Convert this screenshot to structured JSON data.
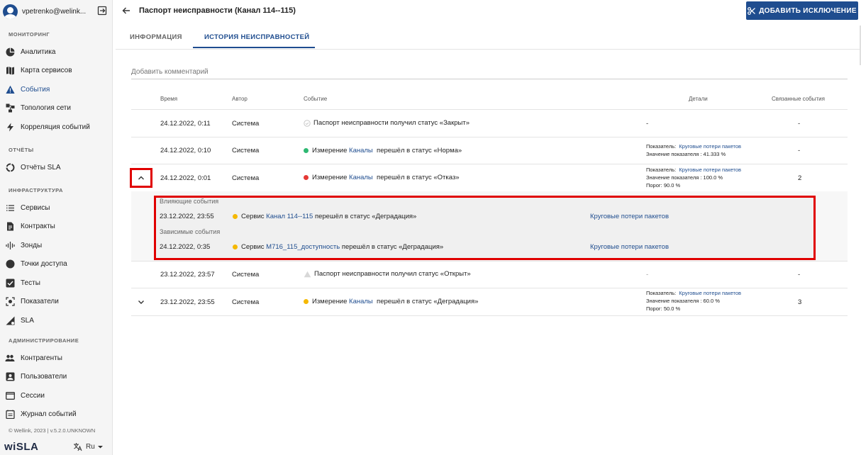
{
  "user": {
    "email": "vpetrenko@welink..."
  },
  "sidebar": {
    "sections": [
      {
        "title": "МОНИТОРИНГ",
        "items": [
          {
            "label": "Аналитика",
            "icon": "pie-chart-icon"
          },
          {
            "label": "Карта сервисов",
            "icon": "map-icon"
          },
          {
            "label": "События",
            "icon": "warning-icon",
            "active": true
          },
          {
            "label": "Топология сети",
            "icon": "topology-icon"
          },
          {
            "label": "Корреляция событий",
            "icon": "lightning-icon"
          }
        ]
      },
      {
        "title": "ОТЧЁТЫ",
        "items": [
          {
            "label": "Отчёты SLA",
            "icon": "report-circle-icon"
          }
        ]
      },
      {
        "title": "ИНФРАСТРУКТУРА",
        "items": [
          {
            "label": "Сервисы",
            "icon": "list-icon"
          },
          {
            "label": "Контракты",
            "icon": "document-icon"
          },
          {
            "label": "Зонды",
            "icon": "signal-icon"
          },
          {
            "label": "Точки доступа",
            "icon": "circle-icon"
          },
          {
            "label": "Тесты",
            "icon": "checkbox-icon"
          },
          {
            "label": "Показатели",
            "icon": "gauge-icon"
          },
          {
            "label": "SLA",
            "icon": "sla-icon"
          }
        ]
      },
      {
        "title": "АДМИНИСТРИРОВАНИЕ",
        "items": [
          {
            "label": "Контрагенты",
            "icon": "people-icon"
          },
          {
            "label": "Пользователи",
            "icon": "user-card-icon"
          },
          {
            "label": "Сессии",
            "icon": "window-icon"
          },
          {
            "label": "Журнал событий",
            "icon": "journal-icon"
          }
        ]
      }
    ],
    "copyright": "© Wellink, 2023 | v.5.2.0.UNKNOWN",
    "logo": "wiSLA",
    "lang": "Ru"
  },
  "header": {
    "title": "Паспорт неисправности (Канал 114--115)",
    "add_exception": "ДОБАВИТЬ ИСКЛЮЧЕНИЕ"
  },
  "tabs": [
    {
      "label": "ИНФОРМАЦИЯ"
    },
    {
      "label": "ИСТОРИЯ НЕИСПРАВНОСТЕЙ",
      "active": true
    }
  ],
  "comment_placeholder": "Добавить комментарий",
  "columns": {
    "time": "Время",
    "author": "Автор",
    "event": "Событие",
    "details": "Детали",
    "related": "Связанные события"
  },
  "rows": [
    {
      "time": "24.12.2022, 0:11",
      "author": "Система",
      "event_prefix": "Паспорт неисправности получил статус «Закрыт»",
      "event_link": "",
      "event_suffix": "",
      "status_color": "#cccccc",
      "details": "-",
      "related": "-"
    },
    {
      "time": "24.12.2022, 0:10",
      "author": "Система",
      "event_prefix": "Измерение",
      "event_link": "Каналы",
      "event_suffix": "перешёл в статус «Норма»",
      "status_color": "#2eb872",
      "details_lines": [
        {
          "label": "Показатель:",
          "value": "Круговые потери пакетов"
        },
        {
          "label": "Значение показателя :",
          "value": "41.333 %"
        }
      ],
      "related": "-"
    },
    {
      "time": "24.12.2022, 0:01",
      "author": "Система",
      "event_prefix": "Измерение",
      "event_link": "Каналы",
      "event_suffix": "перешёл в статус «Отказ»",
      "status_color": "#e53935",
      "details_lines": [
        {
          "label": "Показатель:",
          "value": "Круговые потери пакетов"
        },
        {
          "label": "Значение показателя :",
          "value": "100.0 %"
        },
        {
          "label": "Порог:",
          "value": "90.0 %"
        }
      ],
      "related": "2"
    },
    {
      "time": "23.12.2022, 23:57",
      "author": "Система",
      "event_prefix": "Паспорт неисправности получил статус «Открыт»",
      "event_link": "",
      "event_suffix": "",
      "status_color": "#cccccc",
      "details": "-",
      "related": "-"
    },
    {
      "time": "23.12.2022, 23:55",
      "author": "Система",
      "event_prefix": "Измерение",
      "event_link": "Каналы",
      "event_suffix": "перешёл в статус «Деградация»",
      "status_color": "#f5b800",
      "details_lines": [
        {
          "label": "Показатель:",
          "value": "Круговые потери пакетов"
        },
        {
          "label": "Значение показателя :",
          "value": "60.0 %"
        },
        {
          "label": "Порог:",
          "value": "50.0 %"
        }
      ],
      "related": "3"
    }
  ],
  "expanded": {
    "influencing_label": "Влияющие события",
    "influencing": {
      "time": "23.12.2022, 23:55",
      "prefix": "Сервис",
      "link": "Канал 114--115",
      "suffix": "перешёл в статус «Деградация»",
      "status_color": "#f5b800",
      "indicator": "Круговые потери пакетов"
    },
    "dependent_label": "Зависимые события",
    "dependent": {
      "time": "24.12.2022, 0:35",
      "prefix": "Сервис",
      "link": "M716_115_доступность",
      "suffix": "перешёл в статус «Деградация»",
      "status_color": "#f5b800",
      "indicator": "Круговые потери пакетов"
    }
  }
}
